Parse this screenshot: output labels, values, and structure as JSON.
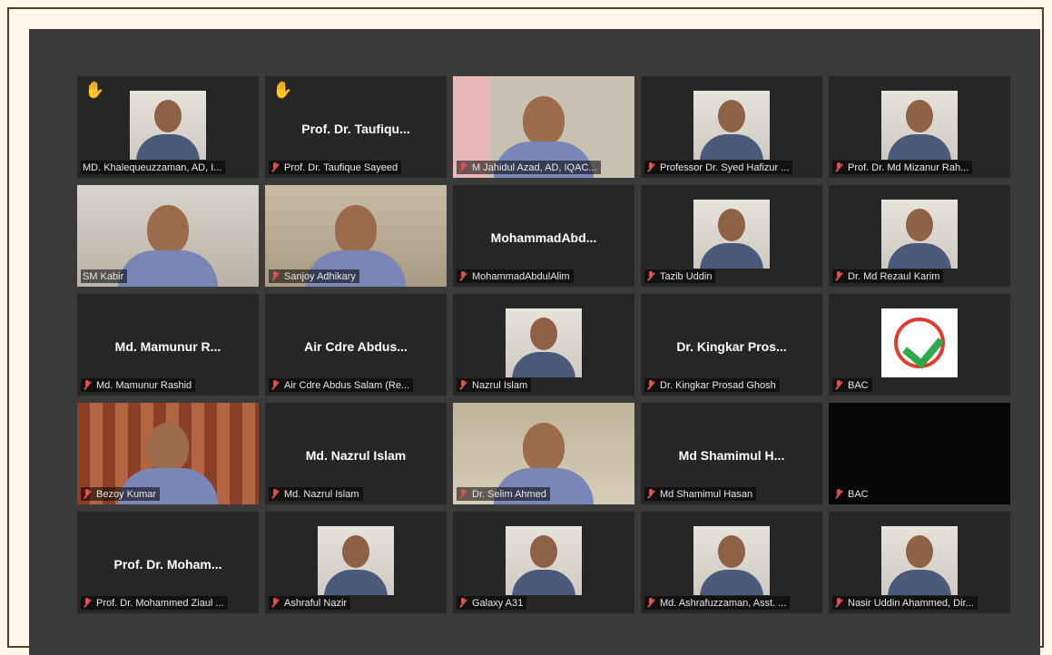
{
  "meeting": {
    "participants": [
      {
        "label": "MD. Khalequeuzzaman, AD, I...",
        "display": "",
        "hand": true,
        "type": "photo",
        "muted": false
      },
      {
        "label": "Prof. Dr. Taufique Sayeed",
        "display": "Prof. Dr. Taufiqu...",
        "hand": true,
        "type": "name",
        "muted": true
      },
      {
        "label": "M Jahidul Azad, AD, IQAC...",
        "display": "",
        "hand": false,
        "type": "video",
        "muted": true
      },
      {
        "label": "Professor Dr. Syed Hafizur ...",
        "display": "",
        "hand": false,
        "type": "photo",
        "muted": true
      },
      {
        "label": "Prof. Dr. Md Mizanur Rah...",
        "display": "",
        "hand": false,
        "type": "photo",
        "muted": true
      },
      {
        "label": "SM Kabir",
        "display": "",
        "hand": false,
        "type": "video",
        "muted": false,
        "active": true
      },
      {
        "label": "Sanjoy Adhikary",
        "display": "",
        "hand": false,
        "type": "video",
        "muted": true
      },
      {
        "label": "MohammadAbdulAlim",
        "display": "MohammadAbd...",
        "hand": false,
        "type": "name",
        "muted": true
      },
      {
        "label": "Tazib Uddin",
        "display": "",
        "hand": false,
        "type": "photo",
        "muted": true
      },
      {
        "label": "Dr. Md Rezaul Karim",
        "display": "",
        "hand": false,
        "type": "photo",
        "muted": true
      },
      {
        "label": "Md. Mamunur Rashid",
        "display": "Md. Mamunur R...",
        "hand": false,
        "type": "name",
        "muted": true
      },
      {
        "label": "Air Cdre  Abdus Salam (Re...",
        "display": "Air Cdre  Abdus...",
        "hand": false,
        "type": "name",
        "muted": true
      },
      {
        "label": "Nazrul Islam",
        "display": "",
        "hand": false,
        "type": "photo",
        "muted": true
      },
      {
        "label": "Dr. Kingkar Prosad Ghosh",
        "display": "Dr. Kingkar Pros...",
        "hand": false,
        "type": "name",
        "muted": true
      },
      {
        "label": "BAC",
        "display": "",
        "hand": false,
        "type": "logo",
        "muted": true
      },
      {
        "label": "Bezoy Kumar",
        "display": "",
        "hand": false,
        "type": "video",
        "muted": true
      },
      {
        "label": "Md. Nazrul Islam",
        "display": "Md. Nazrul Islam",
        "hand": false,
        "type": "name",
        "muted": true
      },
      {
        "label": "Dr. Selim Ahmed",
        "display": "",
        "hand": false,
        "type": "video",
        "muted": true
      },
      {
        "label": "Md Shamimul Hasan",
        "display": "Md Shamimul H...",
        "hand": false,
        "type": "name",
        "muted": true
      },
      {
        "label": "BAC",
        "display": "",
        "hand": false,
        "type": "black",
        "muted": true
      },
      {
        "label": "Prof. Dr. Mohammed Ziaul ...",
        "display": "Prof. Dr. Moham...",
        "hand": false,
        "type": "name",
        "muted": true
      },
      {
        "label": "Ashraful Nazir",
        "display": "",
        "hand": false,
        "type": "photo",
        "muted": true
      },
      {
        "label": "Galaxy A31",
        "display": "",
        "hand": false,
        "type": "photo",
        "muted": true
      },
      {
        "label": "Md. Ashrafuzzaman, Asst. ...",
        "display": "",
        "hand": false,
        "type": "photo",
        "muted": true
      },
      {
        "label": "Nasir Uddin Ahammed, Dir...",
        "display": "",
        "hand": false,
        "type": "photo",
        "muted": true
      }
    ]
  }
}
